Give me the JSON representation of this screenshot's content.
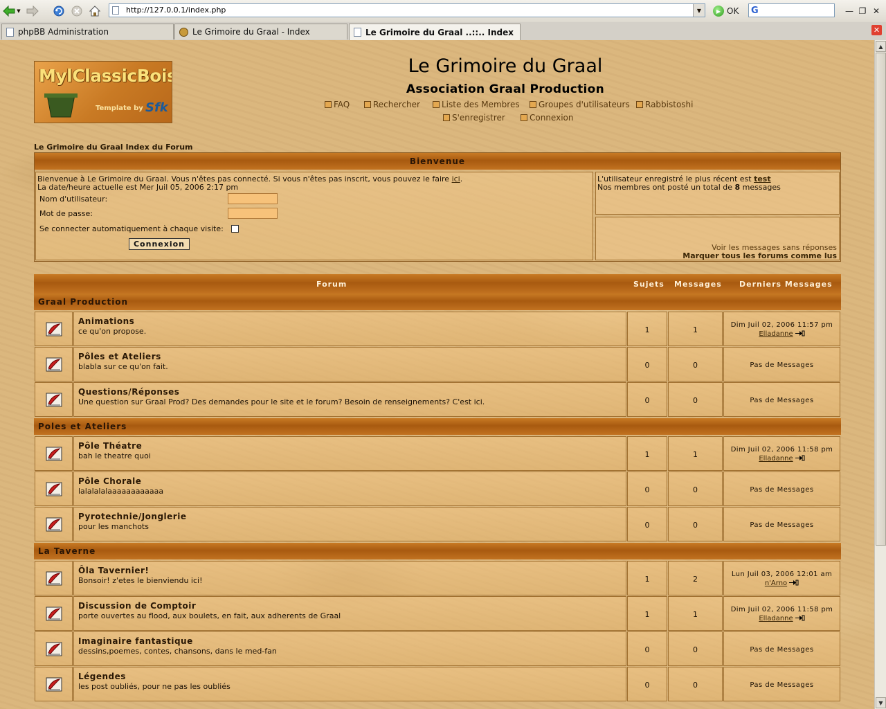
{
  "browser": {
    "url": "http://127.0.0.1/index.php",
    "go_label": "OK",
    "tabs": [
      {
        "label": "phpBB Administration"
      },
      {
        "label": "Le Grimoire du Graal - Index"
      },
      {
        "label": "Le Grimoire du Graal ..::.. Index"
      }
    ]
  },
  "logo": {
    "text": "MylClassicBois",
    "sub": "Template by",
    "sig": "Sfk"
  },
  "header": {
    "title": "Le Grimoire du Graal",
    "subtitle": "Association Graal Production",
    "links": {
      "faq": "FAQ",
      "search": "Rechercher",
      "members": "Liste des Membres",
      "groups": "Groupes d'utilisateurs",
      "rabbi": "Rabbistoshi",
      "register": "S'enregistrer",
      "login": "Connexion"
    }
  },
  "breadcrumb": "Le Grimoire du Graal Index du Forum",
  "welcome": {
    "heading": "Bienvenue",
    "line1": "Bienvenue à Le Grimoire du Graal. Vous n'êtes pas connecté. Si vous n'êtes pas inscrit, vous pouvez le faire",
    "line1_link": "ici",
    "line2": "La date/heure actuelle est Mer Juil 05, 2006 2:17 pm",
    "username_label": "Nom d'utilisateur:",
    "password_label": "Mot de passe:",
    "autologin_label": "Se connecter automatiquement à chaque visite:",
    "login_button": "Connexion",
    "newest_prefix": "L'utilisateur enregistré le plus récent est",
    "newest_user": "test",
    "posts_prefix": "Nos membres ont posté un total de",
    "posts_total": "8",
    "posts_suffix": "messages",
    "unanswered": "Voir les messages sans réponses",
    "mark_read": "Marquer tous les forums comme lus"
  },
  "table_head": {
    "forum": "Forum",
    "topics": "Sujets",
    "posts": "Messages",
    "last": "Derniers Messages"
  },
  "no_posts": "Pas de Messages",
  "categories": [
    {
      "name": "Graal Production",
      "forums": [
        {
          "name": "Animations",
          "desc": "ce qu'on propose.",
          "topics": "1",
          "posts": "1",
          "last_date": "Dim Juil 02, 2006 11:57 pm",
          "last_user": "Elladanne"
        },
        {
          "name": "Pôles et Ateliers",
          "desc": "blabla sur ce qu'on fait.",
          "topics": "0",
          "posts": "0"
        },
        {
          "name": "Questions/Réponses",
          "desc": "Une question sur Graal Prod? Des demandes pour le site et le forum? Besoin de renseignements? C'est ici.",
          "topics": "0",
          "posts": "0"
        }
      ]
    },
    {
      "name": "Poles et Ateliers",
      "forums": [
        {
          "name": "Pôle Théatre",
          "desc": "bah le theatre quoi",
          "topics": "1",
          "posts": "1",
          "last_date": "Dim Juil 02, 2006 11:58 pm",
          "last_user": "Elladanne"
        },
        {
          "name": "Pôle Chorale",
          "desc": "lalalalalaaaaaaaaaaaa",
          "topics": "0",
          "posts": "0"
        },
        {
          "name": "Pyrotechnie/Jonglerie",
          "desc": "pour les manchots",
          "topics": "0",
          "posts": "0"
        }
      ]
    },
    {
      "name": "La Taverne",
      "forums": [
        {
          "name": "Ôla Tavernier!",
          "desc": "Bonsoir! z'etes le bienviendu ici!",
          "topics": "1",
          "posts": "2",
          "last_date": "Lun Juil 03, 2006 12:01 am",
          "last_user": "n'Arno"
        },
        {
          "name": "Discussion de Comptoir",
          "desc": "porte ouvertes au flood, aux boulets, en fait, aux adherents de Graal",
          "topics": "1",
          "posts": "1",
          "last_date": "Dim Juil 02, 2006 11:58 pm",
          "last_user": "Elladanne"
        },
        {
          "name": "Imaginaire fantastique",
          "desc": "dessins,poemes, contes, chansons, dans le med-fan",
          "topics": "0",
          "posts": "0"
        },
        {
          "name": "Légendes",
          "desc": "les post oubliés, pour ne pas les oubliés",
          "topics": "0",
          "posts": "0"
        }
      ]
    }
  ]
}
